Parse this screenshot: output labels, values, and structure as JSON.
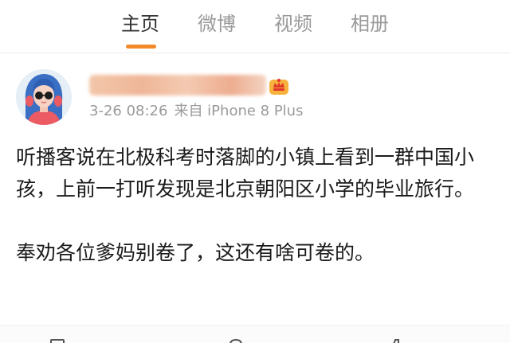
{
  "tabs": [
    {
      "label": "主页",
      "active": true
    },
    {
      "label": "微博",
      "active": false
    },
    {
      "label": "视频",
      "active": false
    },
    {
      "label": "相册",
      "active": false
    }
  ],
  "colors": {
    "accent": "#f08a2b",
    "tab_active": "#333333",
    "tab_inactive": "#9a9a9a",
    "meta_text": "#9a9a9a",
    "body_text": "#1a1a1a"
  },
  "post": {
    "username_redacted": true,
    "badge_icon": "vip-crown-badge-icon",
    "date": "3-26 08:26",
    "source": "来自 iPhone 8 Plus",
    "paragraphs": [
      "听播客说在北极科考时落脚的小镇上看到一群中国小孩，上前一打听发现是北京朝阳区小学的毕业旅行。",
      "奉劝各位爹妈别卷了，这还有啥可卷的。"
    ]
  },
  "actions": [
    {
      "icon": "repost-icon"
    },
    {
      "icon": "comment-icon"
    },
    {
      "icon": "like-icon"
    }
  ]
}
